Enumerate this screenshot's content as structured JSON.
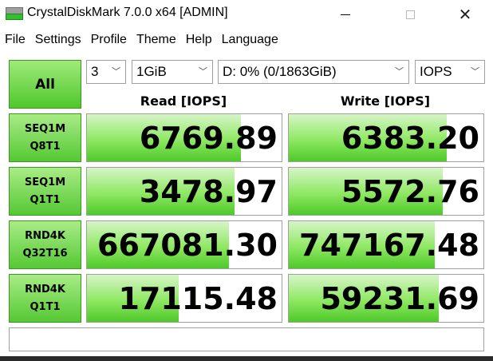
{
  "window": {
    "title": "CrystalDiskMark 7.0.0 x64 [ADMIN]",
    "minimize_icon": "minimize-icon",
    "maximize_icon": "maximize-icon",
    "close_glyph": "✕"
  },
  "menu": [
    "File",
    "Settings",
    "Profile",
    "Theme",
    "Help",
    "Language"
  ],
  "controls": {
    "all_label": "All",
    "count": "3",
    "size": "1GiB",
    "drive": "D: 0% (0/1863GiB)",
    "unit": "IOPS",
    "dropdown_arrow": "﹀"
  },
  "headers": {
    "read": "Read [IOPS]",
    "write": "Write [IOPS]"
  },
  "tests": [
    {
      "line1": "SEQ1M",
      "line2": "Q8T1",
      "read": "6769.89",
      "write": "6383.20",
      "read_fill": 0.79,
      "write_fill": 0.81
    },
    {
      "line1": "SEQ1M",
      "line2": "Q1T1",
      "read": "3478.97",
      "write": "5572.76",
      "read_fill": 0.76,
      "write_fill": 0.79
    },
    {
      "line1": "RND4K",
      "line2": "Q32T16",
      "read": "667081.30",
      "write": "747167.48",
      "read_fill": 0.73,
      "write_fill": 0.75
    },
    {
      "line1": "RND4K",
      "line2": "Q1T1",
      "read": "17115.48",
      "write": "59231.69",
      "read_fill": 0.47,
      "write_fill": 0.77
    }
  ],
  "comment": "",
  "colors": {
    "accent_green": "#4ec929",
    "border": "#a0a0a0"
  }
}
